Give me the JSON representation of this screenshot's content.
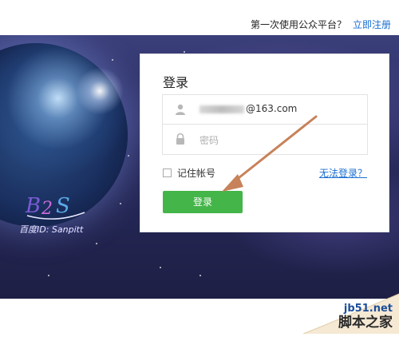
{
  "topbar": {
    "prompt": "第一次使用公众平台？",
    "register_link": "立即注册"
  },
  "hero": {
    "watermark": "百度ID: Sanpitt"
  },
  "login": {
    "title": "登录",
    "account_value": "@163.com",
    "password_placeholder": "密码",
    "remember_label": "记住帐号",
    "remember_checked": false,
    "forgot_link": "无法登录？",
    "submit_label": "登录"
  },
  "colors": {
    "accent_green": "#44b549",
    "link_blue": "#1a6fd1",
    "arrow_brown": "#c7825a"
  },
  "icons": {
    "user": "person-icon",
    "password": "lock-icon"
  },
  "corner_watermark": {
    "site": "jb51.net",
    "name": "脚本之家"
  }
}
